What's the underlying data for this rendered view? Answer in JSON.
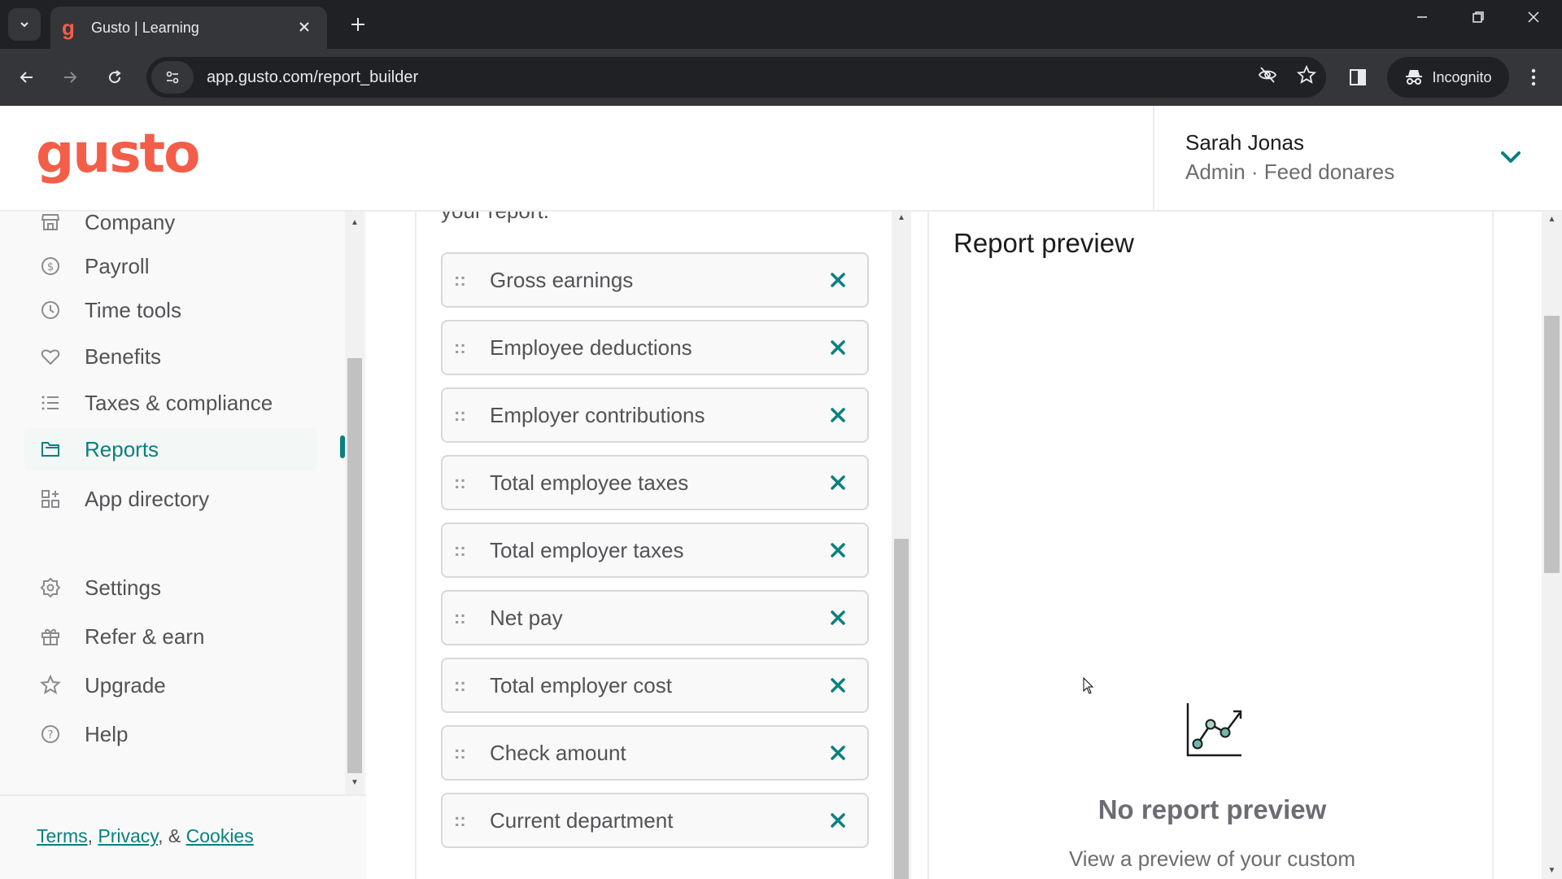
{
  "browser": {
    "tab_title": "Gusto | Learning",
    "favicon_glyph": "g",
    "url": "app.gusto.com/report_builder",
    "incognito_label": "Incognito",
    "icons": {
      "tab_search": "chevron-down-icon",
      "close_tab": "close-icon",
      "new_tab": "plus-icon",
      "back": "arrow-left-icon",
      "forward": "arrow-right-icon",
      "reload": "reload-icon",
      "site_info": "tune-icon",
      "tracking": "eye-off-icon",
      "bookmark": "star-icon",
      "side_panel": "side-panel-icon",
      "incognito": "incognito-icon",
      "menu": "kebab-icon",
      "minimize": "minimize-icon",
      "restore": "restore-icon",
      "close_window": "close-icon"
    }
  },
  "header": {
    "logo_text": "gusto",
    "user_name": "Sarah Jonas",
    "user_role": "Admin · Feed donares"
  },
  "sidebar": {
    "items": [
      {
        "label": "Company",
        "icon": "storefront-icon",
        "active": false
      },
      {
        "label": "Payroll",
        "icon": "dollar-circle-icon",
        "active": false
      },
      {
        "label": "Time tools",
        "icon": "clock-icon",
        "active": false
      },
      {
        "label": "Benefits",
        "icon": "heart-icon",
        "active": false
      },
      {
        "label": "Taxes & compliance",
        "icon": "list-icon",
        "active": false
      },
      {
        "label": "Reports",
        "icon": "folder-icon",
        "active": true
      },
      {
        "label": "App directory",
        "icon": "apps-add-icon",
        "active": false
      },
      {
        "label": "Settings",
        "icon": "gear-icon",
        "active": false
      },
      {
        "label": "Refer & earn",
        "icon": "gift-icon",
        "active": false
      },
      {
        "label": "Upgrade",
        "icon": "star-icon",
        "active": false
      },
      {
        "label": "Help",
        "icon": "help-circle-icon",
        "active": false
      }
    ],
    "footer": {
      "terms": "Terms",
      "sep1": ", ",
      "privacy": "Privacy",
      "sep2": ", & ",
      "cookies": "Cookies"
    }
  },
  "columns_panel": {
    "intro_text": "your report.",
    "selected_columns": [
      "Gross earnings",
      "Employee deductions",
      "Employer contributions",
      "Total employee taxes",
      "Total employer taxes",
      "Net pay",
      "Total employer cost",
      "Check amount",
      "Current department"
    ],
    "grip_glyph": "::"
  },
  "preview": {
    "title": "Report preview",
    "empty_title": "No report preview",
    "empty_subtitle": "View a preview of your custom"
  },
  "colors": {
    "brand": "#f45d48",
    "accent": "#0a8080",
    "text_dark": "#1c1c1c",
    "text_muted": "#6c6c72"
  }
}
